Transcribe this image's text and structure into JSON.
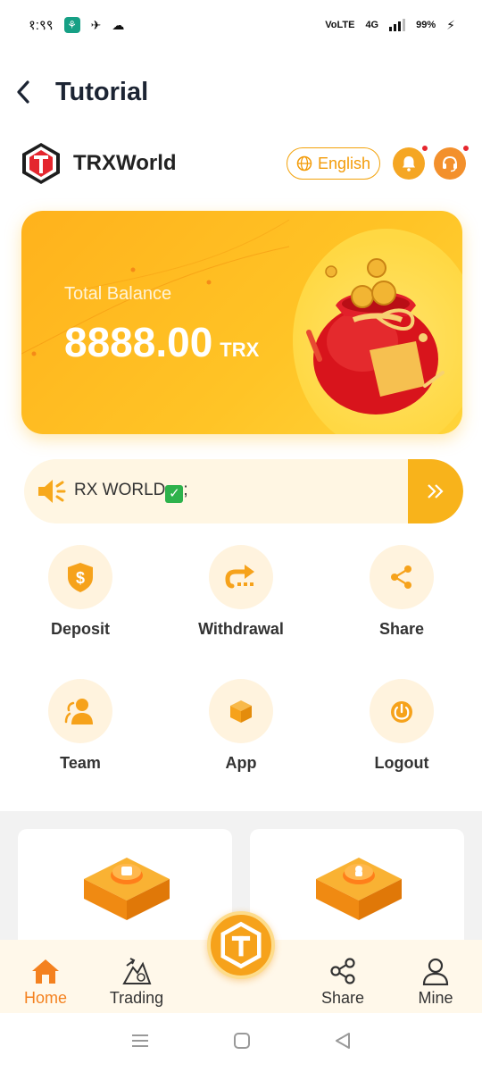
{
  "status_bar": {
    "time": "१:९९",
    "network": "VoLTE",
    "signal": "4G",
    "battery": "99%"
  },
  "header": {
    "title": "Tutorial"
  },
  "brand": {
    "name": "TRXWorld",
    "language": "English"
  },
  "balance": {
    "label": "Total Balance",
    "amount": "8888.00",
    "unit": "TRX"
  },
  "notice": {
    "text": "RX WORLD"
  },
  "actions": [
    {
      "label": "Deposit",
      "icon": "dollar-shield-icon"
    },
    {
      "label": "Withdrawal",
      "icon": "redirect-arrow-icon"
    },
    {
      "label": "Share",
      "icon": "share-icon"
    },
    {
      "label": "Team",
      "icon": "team-icon"
    },
    {
      "label": "App",
      "icon": "cube-icon"
    },
    {
      "label": "Logout",
      "icon": "power-icon"
    }
  ],
  "tabs": [
    {
      "label": "Home",
      "icon": "home-icon",
      "active": true
    },
    {
      "label": "Trading",
      "icon": "trading-icon",
      "active": false
    },
    {
      "label": "Share",
      "icon": "share-icon",
      "active": false
    },
    {
      "label": "Mine",
      "icon": "user-icon",
      "active": false
    }
  ],
  "colors": {
    "accent": "#F6A21B",
    "active_tab": "#F4811F",
    "title": "#1C2433",
    "badge": "#E6262E"
  }
}
